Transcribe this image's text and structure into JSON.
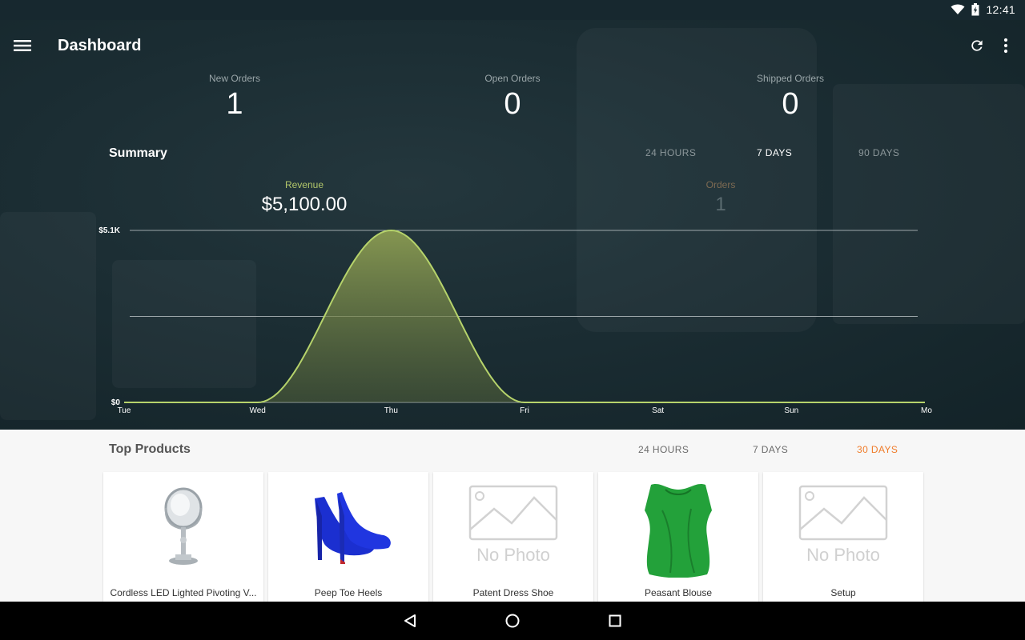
{
  "status_bar": {
    "time": "12:41"
  },
  "app_bar": {
    "title": "Dashboard"
  },
  "stats": [
    {
      "label": "New Orders",
      "value": "1"
    },
    {
      "label": "Open Orders",
      "value": "0"
    },
    {
      "label": "Shipped Orders",
      "value": "0"
    }
  ],
  "summary": {
    "title": "Summary",
    "ranges": [
      "24 HOURS",
      "7 DAYS",
      "90 DAYS"
    ],
    "active_range": "7 DAYS",
    "revenue": {
      "label": "Revenue",
      "value": "$5,100.00"
    },
    "orders": {
      "label": "Orders",
      "value": "1"
    }
  },
  "chart_data": {
    "type": "area",
    "categories": [
      "Tue",
      "Wed",
      "Thu",
      "Fri",
      "Sat",
      "Sun",
      "Mon"
    ],
    "x_tick_labels": [
      "Tue",
      "Wed",
      "Thu",
      "Fri",
      "Sat",
      "Sun",
      "Mo"
    ],
    "series": [
      {
        "values": [
          0,
          0,
          5100,
          0,
          0,
          0,
          0
        ]
      }
    ],
    "y_tick_labels": [
      "$0",
      "$5.1K"
    ],
    "ylim": [
      0,
      5100
    ],
    "grid": true,
    "colors": {
      "line": "#b6d36b",
      "fill": "#889a52"
    }
  },
  "top_products": {
    "title": "Top Products",
    "ranges": [
      "24 HOURS",
      "7 DAYS",
      "30 DAYS"
    ],
    "active_range": "30 DAYS",
    "items": [
      {
        "name": "Cordless LED Lighted Pivoting V...",
        "image": "vanity-mirror"
      },
      {
        "name": "Peep Toe Heels",
        "image": "blue-heels"
      },
      {
        "name": "Patent Dress Shoe",
        "image": "no-photo",
        "placeholder_text": "No Photo"
      },
      {
        "name": "Peasant Blouse",
        "image": "green-blouse"
      },
      {
        "name": "Setup",
        "image": "no-photo",
        "placeholder_text": "No Photo"
      }
    ]
  },
  "colors": {
    "hero_bg": "#1b2d33",
    "accent_orange": "#f07c2b",
    "revenue_label": "#b3c76a",
    "orders_label": "#7d6a52"
  },
  "icons": {
    "menu": "menu-icon",
    "refresh": "refresh-icon",
    "overflow": "more-vert-icon",
    "wifi": "wifi-icon",
    "battery": "battery-charging-icon",
    "back": "back-icon",
    "home": "home-icon",
    "recents": "recents-icon"
  }
}
